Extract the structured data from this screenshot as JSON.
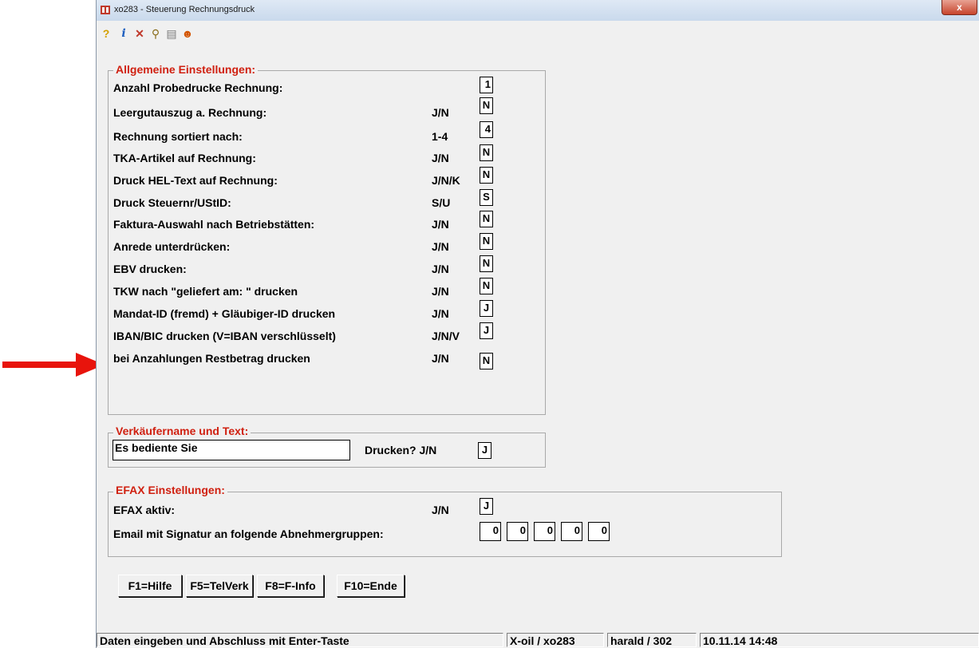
{
  "window": {
    "title": "xo283 - Steuerung Rechnungsdruck",
    "close_label": "x"
  },
  "toolbar": {
    "icons": [
      "help-icon",
      "info-icon",
      "delete-icon",
      "search-icon",
      "print-icon",
      "user-icon"
    ]
  },
  "general": {
    "legend": "Allgemeine Einstellungen:",
    "rows": [
      {
        "label": "Anzahl Probedrucke Rechnung:",
        "format": "",
        "value": "1"
      },
      {
        "label": "Leergutauszug a. Rechnung:",
        "format": "J/N",
        "value": "N"
      },
      {
        "label": "Rechnung sortiert nach:",
        "format": "1-4",
        "value": "4"
      },
      {
        "label": "TKA-Artikel auf Rechnung:",
        "format": "J/N",
        "value": "N"
      },
      {
        "label": "Druck HEL-Text auf Rechnung:",
        "format": "J/N/K",
        "value": "N"
      },
      {
        "label": "Druck Steuernr/UStID:",
        "format": "S/U",
        "value": "S"
      },
      {
        "label": "Faktura-Auswahl nach Betriebstätten:",
        "format": "J/N",
        "value": "N"
      },
      {
        "label": "Anrede unterdrücken:",
        "format": "J/N",
        "value": "N"
      },
      {
        "label": "EBV drucken:",
        "format": "J/N",
        "value": "N"
      },
      {
        "label": "TKW nach \"geliefert am: \" drucken",
        "format": "J/N",
        "value": "N"
      },
      {
        "label": "Mandat-ID (fremd) + Gläubiger-ID drucken",
        "format": "J/N",
        "value": "J"
      },
      {
        "label": "IBAN/BIC drucken  (V=IBAN verschlüsselt)",
        "format": "J/N/V",
        "value": "J"
      },
      {
        "label": "bei Anzahlungen Restbetrag drucken",
        "format": "J/N",
        "value": "N"
      }
    ]
  },
  "seller": {
    "legend": "Verkäufername und Text:",
    "text_value": "Es bediente Sie",
    "print_label": "Drucken? J/N",
    "print_value": "J"
  },
  "efax": {
    "legend": "EFAX Einstellungen:",
    "active_label": "EFAX aktiv:",
    "active_format": "J/N",
    "active_value": "J",
    "email_label": "Email mit Signatur an folgende Abnehmergruppen:",
    "groups": [
      "0",
      "0",
      "0",
      "0",
      "0"
    ]
  },
  "buttons": [
    "F1=Hilfe",
    "F5=TelVerk",
    "F8=F-Info",
    "F10=Ende"
  ],
  "status": {
    "message": "Daten eingeben und Abschluss mit Enter-Taste",
    "app": "X-oil / xo283",
    "user": "harald / 302",
    "datetime": "10.11.14 14:48"
  },
  "colors": {
    "legend": "#d02010",
    "arrow": "#e8140c"
  }
}
